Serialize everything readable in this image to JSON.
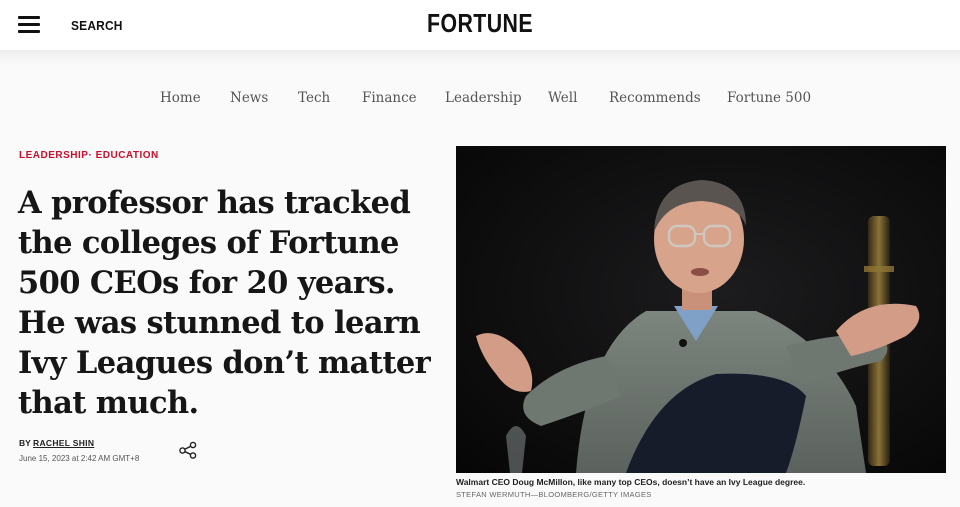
{
  "header": {
    "search_label": "SEARCH",
    "logo_text": "FORTUNE"
  },
  "nav": {
    "items": [
      "Home",
      "News",
      "Tech",
      "Finance",
      "Leadership",
      "Well",
      "Recommends",
      "Fortune 500"
    ]
  },
  "article": {
    "kicker_primary": "LEADERSHIP",
    "kicker_separator": "·",
    "kicker_secondary": "EDUCATION",
    "headline": "A professor has tracked the colleges of Fortune 500 CEOs for 20 years. He was stunned to learn Ivy Leagues don’t matter that much.",
    "byline_prefix": "BY",
    "author": "RACHEL SHIN",
    "date": "June 15, 2023 at 2:42 AM GMT+8"
  },
  "image": {
    "caption": "Walmart CEO Doug McMillon, like many top CEOs, doesn’t have an Ivy League degree.",
    "credit": "STEFAN WERMUTH—BLOOMBERG/GETTY IMAGES"
  },
  "colors": {
    "accent": "#c8102e",
    "nav_text": "#555555",
    "header_bg": "#ffffff",
    "page_bg": "#fafafa"
  }
}
